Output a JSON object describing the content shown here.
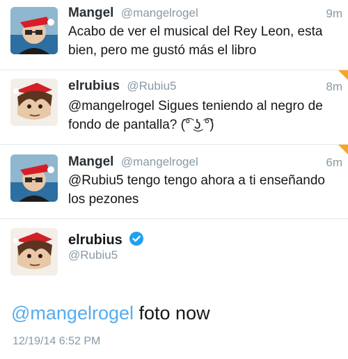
{
  "tweets": [
    {
      "name": "Mangel",
      "handle": "@mangelrogel",
      "time": "9m",
      "text": "Acabo de ver el musical del Rey Leon, esta bien, pero me gustó más el libro"
    },
    {
      "name": "elrubius",
      "handle": "@Rubiu5",
      "time": "8m",
      "text": "@mangelrogel Sigues teniendo al negro de fondo de pantalla? (͡° ͜ʖ ͡°)"
    },
    {
      "name": "Mangel",
      "handle": "@mangelrogel",
      "time": "6m",
      "text": "@Rubiu5 tengo tengo ahora a ti enseñando los pezones"
    }
  ],
  "main_tweet": {
    "name": "elrubius",
    "handle": "@Rubiu5",
    "mention": "@mangelrogel",
    "text": " foto now",
    "date": "12/19/14 6:52 PM"
  },
  "colors": {
    "link": "#55acee",
    "corner_badge": "#f5a623",
    "verified": "#1da1f2"
  }
}
